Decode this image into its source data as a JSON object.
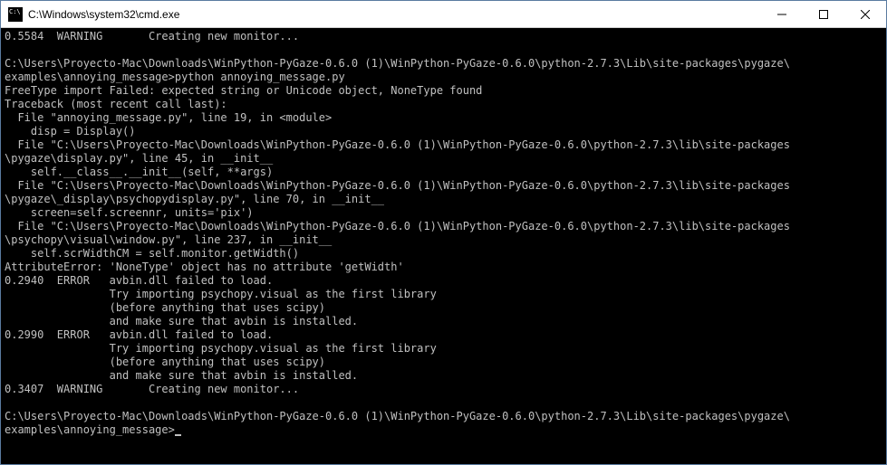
{
  "window": {
    "title": "C:\\Windows\\system32\\cmd.exe"
  },
  "terminal": {
    "lines": [
      "0.5584  WARNING       Creating new monitor...",
      "",
      "C:\\Users\\Proyecto-Mac\\Downloads\\WinPython-PyGaze-0.6.0 (1)\\WinPython-PyGaze-0.6.0\\python-2.7.3\\Lib\\site-packages\\pygaze\\",
      "examples\\annoying_message>python annoying_message.py",
      "FreeType import Failed: expected string or Unicode object, NoneType found",
      "Traceback (most recent call last):",
      "  File \"annoying_message.py\", line 19, in <module>",
      "    disp = Display()",
      "  File \"C:\\Users\\Proyecto-Mac\\Downloads\\WinPython-PyGaze-0.6.0 (1)\\WinPython-PyGaze-0.6.0\\python-2.7.3\\lib\\site-packages",
      "\\pygaze\\display.py\", line 45, in __init__",
      "    self.__class__.__init__(self, **args)",
      "  File \"C:\\Users\\Proyecto-Mac\\Downloads\\WinPython-PyGaze-0.6.0 (1)\\WinPython-PyGaze-0.6.0\\python-2.7.3\\lib\\site-packages",
      "\\pygaze\\_display\\psychopydisplay.py\", line 70, in __init__",
      "    screen=self.screennr, units='pix')",
      "  File \"C:\\Users\\Proyecto-Mac\\Downloads\\WinPython-PyGaze-0.6.0 (1)\\WinPython-PyGaze-0.6.0\\python-2.7.3\\lib\\site-packages",
      "\\psychopy\\visual\\window.py\", line 237, in __init__",
      "    self.scrWidthCM = self.monitor.getWidth()",
      "AttributeError: 'NoneType' object has no attribute 'getWidth'",
      "0.2940  ERROR   avbin.dll failed to load.",
      "                Try importing psychopy.visual as the first library",
      "                (before anything that uses scipy)",
      "                and make sure that avbin is installed.",
      "0.2990  ERROR   avbin.dll failed to load.",
      "                Try importing psychopy.visual as the first library",
      "                (before anything that uses scipy)",
      "                and make sure that avbin is installed.",
      "0.3407  WARNING       Creating new monitor...",
      "",
      "C:\\Users\\Proyecto-Mac\\Downloads\\WinPython-PyGaze-0.6.0 (1)\\WinPython-PyGaze-0.6.0\\python-2.7.3\\Lib\\site-packages\\pygaze\\"
    ],
    "prompt": "examples\\annoying_message>"
  }
}
